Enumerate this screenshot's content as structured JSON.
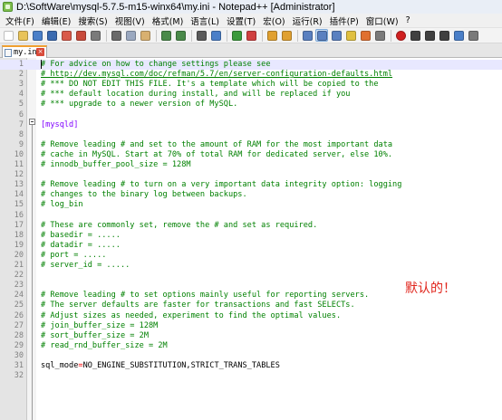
{
  "window": {
    "title": "D:\\SoftWare\\mysql-5.7.5-m15-winx64\\my.ini - Notepad++ [Administrator]"
  },
  "menu": {
    "items": [
      "文件(F)",
      "编辑(E)",
      "搜索(S)",
      "视图(V)",
      "格式(M)",
      "语言(L)",
      "设置(T)",
      "宏(O)",
      "运行(R)",
      "插件(P)",
      "窗口(W)",
      "?"
    ]
  },
  "toolbar": {
    "colors": {
      "new": "#ffffff",
      "open": "#e8c35a",
      "save": "#4a7fc8",
      "saveall": "#3a6ab0",
      "close": "#d95a4a",
      "closeall": "#c84a3a",
      "print": "#7a7a7a",
      "cut": "#6a6a6a",
      "copy": "#9aa8c0",
      "paste": "#d8b070",
      "undo": "#4a8a4a",
      "redo": "#4a8a4a",
      "find": "#5a5a5a",
      "replace": "#4a7fc8",
      "zoomin": "#3a9a3a",
      "zoomout": "#d04040",
      "sync1": "#e0a030",
      "sync2": "#e0a030",
      "wrap": "#5a80c0",
      "allchars": "#5a80c0",
      "indent": "#5a80c0",
      "udl": "#e0c040",
      "docmap": "#e07030",
      "funclist": "#7a7a7a",
      "record": "#d02020",
      "stop": "#404040",
      "play": "#404040",
      "playmulti": "#404040",
      "saverec": "#4a7fc8",
      "macro": "#7a7a7a"
    }
  },
  "tab": {
    "label": "my.ini",
    "close_symbol": "×"
  },
  "editor": {
    "lines": [
      {
        "n": "1",
        "type": "comment",
        "text": "# For advice on how to change settings please see"
      },
      {
        "n": "2",
        "type": "url",
        "text": "# http://dev.mysql.com/doc/refman/5.7/en/server-configuration-defaults.html"
      },
      {
        "n": "3",
        "type": "comment",
        "text": "# *** DO NOT EDIT THIS FILE. It's a template which will be copied to the"
      },
      {
        "n": "4",
        "type": "comment",
        "text": "# *** default location during install, and will be replaced if you"
      },
      {
        "n": "5",
        "type": "comment",
        "text": "# *** upgrade to a newer version of MySQL."
      },
      {
        "n": "6",
        "type": "plain",
        "text": ""
      },
      {
        "n": "7",
        "type": "section",
        "text": "[mysqld]"
      },
      {
        "n": "8",
        "type": "plain",
        "text": ""
      },
      {
        "n": "9",
        "type": "comment",
        "text": "# Remove leading # and set to the amount of RAM for the most important data"
      },
      {
        "n": "10",
        "type": "comment",
        "text": "# cache in MySQL. Start at 70% of total RAM for dedicated server, else 10%."
      },
      {
        "n": "11",
        "type": "comment",
        "text": "# innodb_buffer_pool_size = 128M"
      },
      {
        "n": "12",
        "type": "plain",
        "text": ""
      },
      {
        "n": "13",
        "type": "comment",
        "text": "# Remove leading # to turn on a very important data integrity option: logging"
      },
      {
        "n": "14",
        "type": "comment",
        "text": "# changes to the binary log between backups."
      },
      {
        "n": "15",
        "type": "comment",
        "text": "# log_bin"
      },
      {
        "n": "16",
        "type": "plain",
        "text": ""
      },
      {
        "n": "17",
        "type": "comment",
        "text": "# These are commonly set, remove the # and set as required."
      },
      {
        "n": "18",
        "type": "comment",
        "text": "# basedir = ....."
      },
      {
        "n": "19",
        "type": "comment",
        "text": "# datadir = ....."
      },
      {
        "n": "20",
        "type": "comment",
        "text": "# port = ....."
      },
      {
        "n": "21",
        "type": "comment",
        "text": "# server_id = ....."
      },
      {
        "n": "22",
        "type": "plain",
        "text": ""
      },
      {
        "n": "23",
        "type": "plain",
        "text": ""
      },
      {
        "n": "24",
        "type": "comment",
        "text": "# Remove leading # to set options mainly useful for reporting servers."
      },
      {
        "n": "25",
        "type": "comment",
        "text": "# The server defaults are faster for transactions and fast SELECTs."
      },
      {
        "n": "26",
        "type": "comment",
        "text": "# Adjust sizes as needed, experiment to find the optimal values."
      },
      {
        "n": "27",
        "type": "comment",
        "text": "# join_buffer_size = 128M"
      },
      {
        "n": "28",
        "type": "comment",
        "text": "# sort_buffer_size = 2M"
      },
      {
        "n": "29",
        "type": "comment",
        "text": "# read_rnd_buffer_size = 2M"
      },
      {
        "n": "30",
        "type": "plain",
        "text": ""
      },
      {
        "n": "31",
        "type": "plain",
        "text": "sql_mode=NO_ENGINE_SUBSTITUTION,STRICT_TRANS_TABLES"
      },
      {
        "n": "32",
        "type": "plain",
        "text": ""
      }
    ]
  },
  "annotation": {
    "text": "默认的！",
    "color": "#e0241b"
  }
}
